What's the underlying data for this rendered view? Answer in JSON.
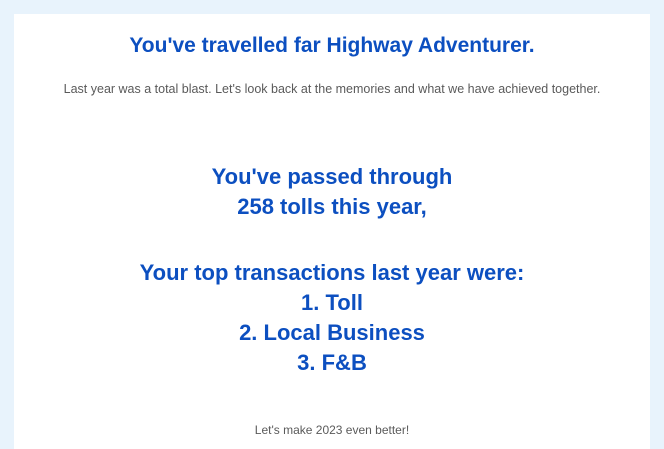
{
  "card": {
    "headline": "You've travelled far Highway Adventurer.",
    "intro": "Last year was a total blast. Let's look back at the memories and what we have achieved together.",
    "tolls_line1": "You've passed through",
    "tolls_line2": "258 tolls this year,",
    "top_heading": "Your top transactions last year were:",
    "top_transactions": [
      "1. Toll",
      "2. Local Business",
      "3. F&B"
    ],
    "footer": "Let's make 2023 even better!"
  },
  "colors": {
    "page_background": "#e8f3fc",
    "card_background": "#ffffff",
    "heading_blue": "#0c4fc0",
    "body_gray": "#5a5a5a"
  }
}
